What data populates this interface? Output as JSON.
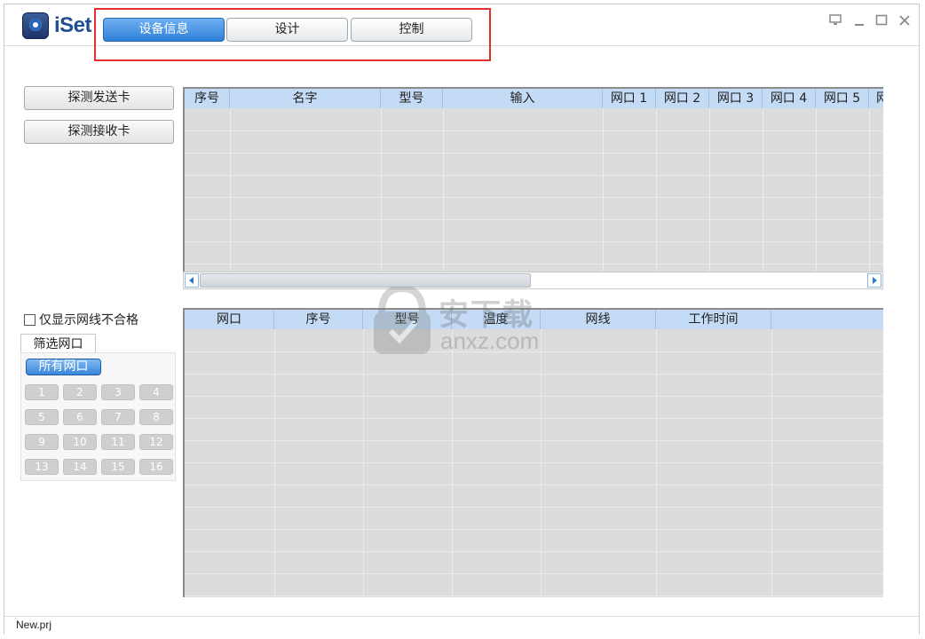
{
  "app": {
    "logo_text": "iSet"
  },
  "tabs": [
    {
      "label": "设备信息",
      "active": true
    },
    {
      "label": "设计",
      "active": false
    },
    {
      "label": "控制",
      "active": false
    }
  ],
  "window_controls": [
    "monitor-icon",
    "minimize-icon",
    "maximize-icon",
    "close-icon"
  ],
  "left_panel": {
    "detect_sender": "探测发送卡",
    "detect_receiver": "探测接收卡",
    "only_bad_cable_label": "仅显示网线不合格",
    "only_bad_cable_checked": false,
    "filter_tab": "筛选网口",
    "all_ports": "所有网口",
    "ports": [
      "1",
      "2",
      "3",
      "4",
      "5",
      "6",
      "7",
      "8",
      "9",
      "10",
      "11",
      "12",
      "13",
      "14",
      "15",
      "16"
    ]
  },
  "sender_table": {
    "columns": [
      "序号",
      "名字",
      "型号",
      "输入",
      "网口 1",
      "网口 2",
      "网口 3",
      "网口 4",
      "网口 5",
      "网"
    ],
    "rows": []
  },
  "receiver_table": {
    "columns": [
      "网口",
      "序号",
      "型号",
      "温度",
      "网线",
      "工作时间"
    ],
    "rows": []
  },
  "status": {
    "project": "New.prj"
  },
  "watermark": {
    "line1": "安下载",
    "line2": "anxz.com"
  },
  "colors": {
    "accent": "#3a86dc",
    "header": "#c4dbf6",
    "grid_bg": "#dcdcdc",
    "highlight": "#e03030"
  }
}
